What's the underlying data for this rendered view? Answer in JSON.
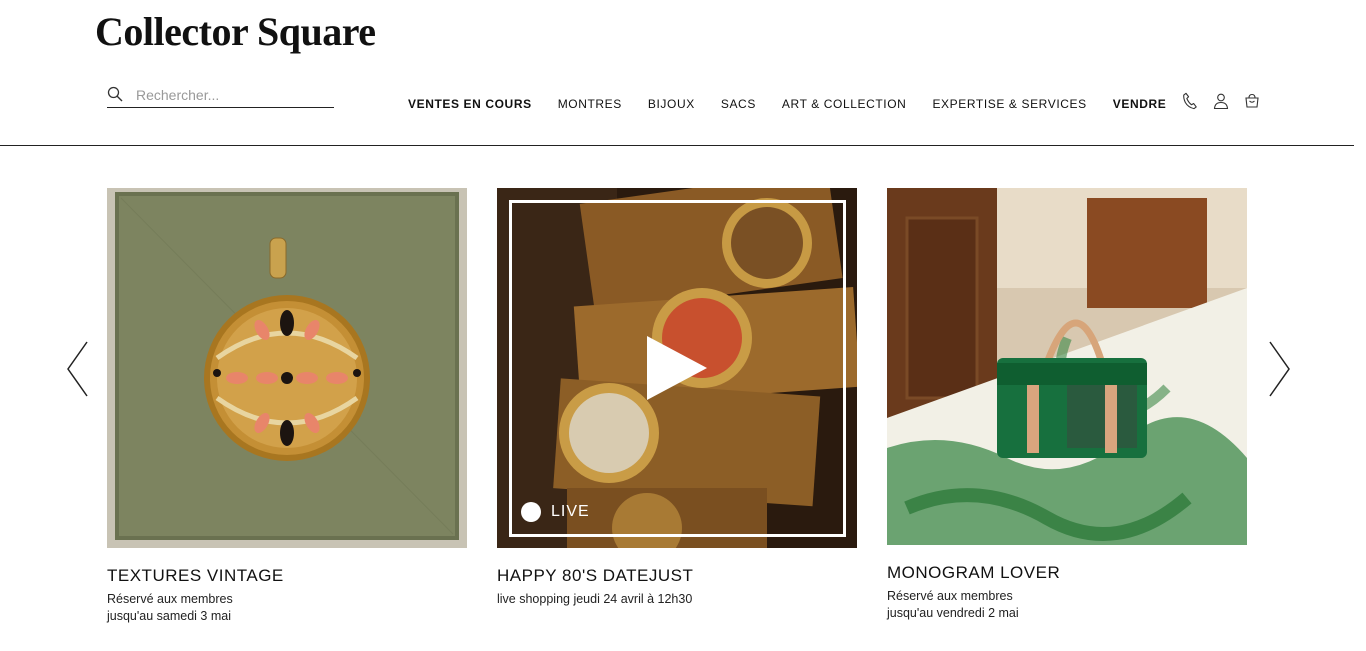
{
  "brand": {
    "logo": "Collector Square"
  },
  "search": {
    "placeholder": "Rechercher..."
  },
  "nav": {
    "items": [
      {
        "label": "VENTES EN COURS",
        "bold": true
      },
      {
        "label": "MONTRES"
      },
      {
        "label": "BIJOUX"
      },
      {
        "label": "SACS"
      },
      {
        "label": "ART & COLLECTION"
      },
      {
        "label": "EXPERTISE & SERVICES"
      },
      {
        "label": "VENDRE",
        "bold": true
      }
    ]
  },
  "utility_icons": [
    "phone-icon",
    "user-icon",
    "cart-icon"
  ],
  "carousel": {
    "cards": [
      {
        "title": "TEXTURES VINTAGE",
        "line1": "Réservé aux membres",
        "line2": "jusqu'au samedi 3 mai"
      },
      {
        "title": "HAPPY 80'S DATEJUST",
        "line1": "live shopping jeudi 24 avril à 12h30",
        "live_label": "LIVE"
      },
      {
        "title": "MONOGRAM LOVER",
        "line1": "Réservé aux membres",
        "line2": "jusqu'au vendredi 2 mai"
      }
    ]
  },
  "colors": {
    "text": "#111111",
    "background": "#ffffff",
    "accent_green": "#1f6b3a"
  }
}
